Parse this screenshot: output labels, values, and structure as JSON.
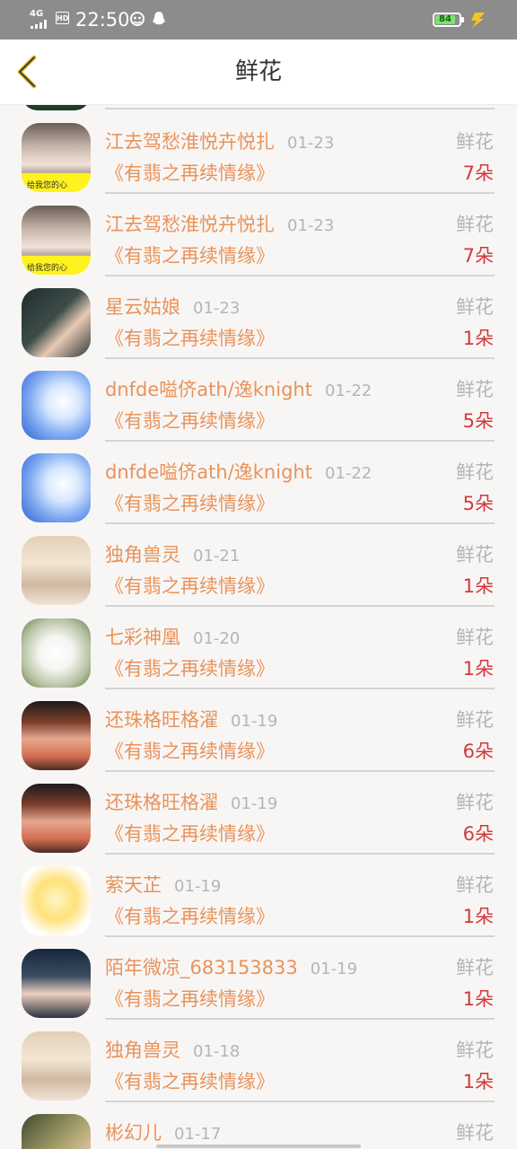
{
  "status_bar": {
    "network": "4G",
    "hd": "HD",
    "time": "22:50",
    "battery": "84",
    "battery_level": 0.84
  },
  "header": {
    "title": "鲜花",
    "back_icon": "chevron-left-icon"
  },
  "colors": {
    "accent": "#e8935a",
    "count": "#d2393c",
    "muted": "#b5b5b5",
    "back": "#e9c233"
  },
  "records": [
    {
      "name": "江去驾愁淮悦卉悦扎",
      "date": "01-23",
      "type": "鲜花",
      "book": "《有翡之再续情缘》",
      "count": "7朵",
      "avatar_note": "给我您的心",
      "avatar": "girl"
    },
    {
      "name": "江去驾愁淮悦卉悦扎",
      "date": "01-23",
      "type": "鲜花",
      "book": "《有翡之再续情缘》",
      "count": "7朵",
      "avatar_note": "给我您的心",
      "avatar": "girl"
    },
    {
      "name": "星云姑娘",
      "date": "01-23",
      "type": "鲜花",
      "book": "《有翡之再续情缘》",
      "count": "1朵",
      "avatar": "boy1"
    },
    {
      "name": "dnfde嗌侪ath/逸knight",
      "date": "01-22",
      "type": "鲜花",
      "book": "《有翡之再续情缘》",
      "count": "5朵",
      "avatar": "snow"
    },
    {
      "name": "dnfde嗌侪ath/逸knight",
      "date": "01-22",
      "type": "鲜花",
      "book": "《有翡之再续情缘》",
      "count": "5朵",
      "avatar": "snow"
    },
    {
      "name": "独角兽灵",
      "date": "01-21",
      "type": "鲜花",
      "book": "《有翡之再续情缘》",
      "count": "1朵",
      "avatar": "couple"
    },
    {
      "name": "七彩神凰",
      "date": "01-20",
      "type": "鲜花",
      "book": "《有翡之再续情缘》",
      "count": "1朵",
      "avatar": "dog"
    },
    {
      "name": "还珠格旺格濯",
      "date": "01-19",
      "type": "鲜花",
      "book": "《有翡之再续情缘》",
      "count": "6朵",
      "avatar": "red"
    },
    {
      "name": "还珠格旺格濯",
      "date": "01-19",
      "type": "鲜花",
      "book": "《有翡之再续情缘》",
      "count": "6朵",
      "avatar": "red"
    },
    {
      "name": "萦天芷",
      "date": "01-19",
      "type": "鲜花",
      "book": "《有翡之再续情缘》",
      "count": "1朵",
      "avatar": "cartoon"
    },
    {
      "name": "陌年微凉_683153833",
      "date": "01-19",
      "type": "鲜花",
      "book": "《有翡之再续情缘》",
      "count": "1朵",
      "avatar": "boy2"
    },
    {
      "name": "独角兽灵",
      "date": "01-18",
      "type": "鲜花",
      "book": "《有翡之再续情缘》",
      "count": "1朵",
      "avatar": "couple"
    },
    {
      "name": "彬幻儿",
      "date": "01-17",
      "type": "鲜花",
      "book": "",
      "count": "",
      "avatar": "mix"
    }
  ]
}
